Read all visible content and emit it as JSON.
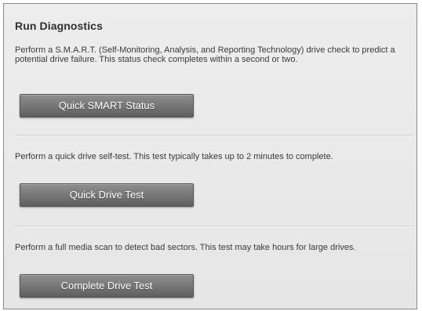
{
  "section": {
    "title": "Run Diagnostics"
  },
  "tests": [
    {
      "description": "Perform a S.M.A.R.T. (Self-Monitoring, Analysis, and Reporting Technology) drive check to predict a potential drive failure. This status check completes within a second or two.",
      "button_label": "Quick SMART Status"
    },
    {
      "description": "Perform a quick drive self-test. This test typically takes up to 2 minutes to complete.",
      "button_label": "Quick Drive Test"
    },
    {
      "description": "Perform a full media scan to detect bad sectors. This test may take hours for large drives.",
      "button_label": "Complete Drive Test"
    }
  ]
}
